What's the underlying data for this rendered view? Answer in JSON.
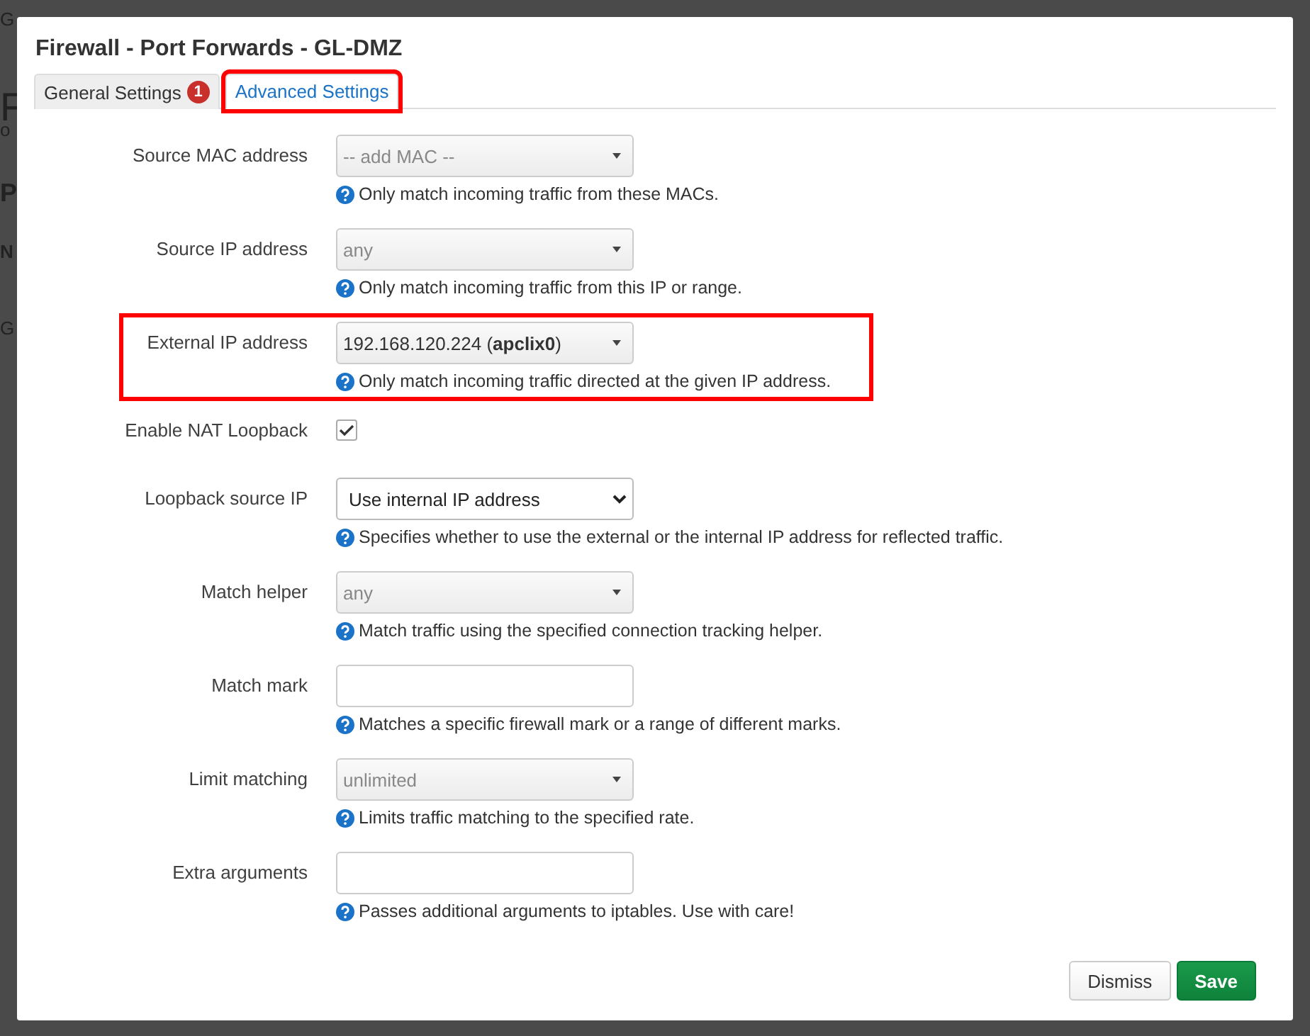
{
  "background_fragments": [
    {
      "text": "G",
      "kind": "small"
    },
    {
      "text": "F",
      "kind": "heading"
    },
    {
      "text": "o",
      "kind": "small"
    },
    {
      "text": "P",
      "kind": "subheading"
    },
    {
      "text": "N",
      "kind": "bold"
    },
    {
      "text": "G",
      "kind": "small"
    }
  ],
  "dialog": {
    "title": "Firewall - Port Forwards - GL-DMZ",
    "tabs": [
      {
        "label": "General Settings",
        "selected": false,
        "badge": "1",
        "highlighted": false
      },
      {
        "label": "Advanced Settings",
        "selected": true,
        "highlighted": true
      }
    ],
    "rows": [
      {
        "label": "Source MAC address",
        "kind": "select",
        "placeholder": "-- add MAC --",
        "help": "Only match incoming traffic from these MACs.",
        "highlighted": false
      },
      {
        "label": "Source IP address",
        "kind": "select",
        "placeholder": "any",
        "help": "Only match incoming traffic from this IP or range.",
        "highlighted": false
      },
      {
        "label": "External IP address",
        "kind": "select",
        "value": "192.168.120.224 (**apclix0**)",
        "help": "Only match incoming traffic directed at the given IP address.",
        "highlighted": true
      },
      {
        "label": "Enable NAT Loopback",
        "kind": "checkbox",
        "checked": true,
        "highlighted": false
      },
      {
        "label": "Loopback source IP",
        "kind": "native-select",
        "value": "Use internal IP address",
        "help": "Specifies whether to use the external or the internal IP address for reflected traffic.",
        "highlighted": false
      },
      {
        "label": "Match helper",
        "kind": "select",
        "placeholder": "any",
        "help": "Match traffic using the specified connection tracking helper.",
        "highlighted": false
      },
      {
        "label": "Match mark",
        "kind": "text",
        "help": "Matches a specific firewall mark or a range of different marks.",
        "highlighted": false
      },
      {
        "label": "Limit matching",
        "kind": "select",
        "placeholder": "unlimited",
        "help": "Limits traffic matching to the specified rate.",
        "highlighted": false
      },
      {
        "label": "Extra arguments",
        "kind": "text",
        "help": "Passes additional arguments to iptables. Use with care!",
        "highlighted": false
      }
    ],
    "buttons": [
      {
        "label": "Dismiss",
        "kind": "default"
      },
      {
        "label": "Save",
        "kind": "primary"
      }
    ]
  }
}
